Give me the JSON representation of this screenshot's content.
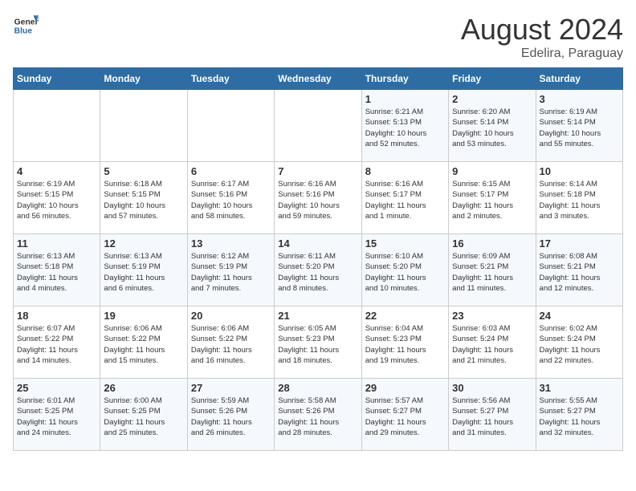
{
  "header": {
    "logo_line1": "General",
    "logo_line2": "Blue",
    "month_title": "August 2024",
    "subtitle": "Edelira, Paraguay"
  },
  "weekdays": [
    "Sunday",
    "Monday",
    "Tuesday",
    "Wednesday",
    "Thursday",
    "Friday",
    "Saturday"
  ],
  "weeks": [
    [
      {
        "day": "",
        "info": ""
      },
      {
        "day": "",
        "info": ""
      },
      {
        "day": "",
        "info": ""
      },
      {
        "day": "",
        "info": ""
      },
      {
        "day": "1",
        "info": "Sunrise: 6:21 AM\nSunset: 5:13 PM\nDaylight: 10 hours\nand 52 minutes."
      },
      {
        "day": "2",
        "info": "Sunrise: 6:20 AM\nSunset: 5:14 PM\nDaylight: 10 hours\nand 53 minutes."
      },
      {
        "day": "3",
        "info": "Sunrise: 6:19 AM\nSunset: 5:14 PM\nDaylight: 10 hours\nand 55 minutes."
      }
    ],
    [
      {
        "day": "4",
        "info": "Sunrise: 6:19 AM\nSunset: 5:15 PM\nDaylight: 10 hours\nand 56 minutes."
      },
      {
        "day": "5",
        "info": "Sunrise: 6:18 AM\nSunset: 5:15 PM\nDaylight: 10 hours\nand 57 minutes."
      },
      {
        "day": "6",
        "info": "Sunrise: 6:17 AM\nSunset: 5:16 PM\nDaylight: 10 hours\nand 58 minutes."
      },
      {
        "day": "7",
        "info": "Sunrise: 6:16 AM\nSunset: 5:16 PM\nDaylight: 10 hours\nand 59 minutes."
      },
      {
        "day": "8",
        "info": "Sunrise: 6:16 AM\nSunset: 5:17 PM\nDaylight: 11 hours\nand 1 minute."
      },
      {
        "day": "9",
        "info": "Sunrise: 6:15 AM\nSunset: 5:17 PM\nDaylight: 11 hours\nand 2 minutes."
      },
      {
        "day": "10",
        "info": "Sunrise: 6:14 AM\nSunset: 5:18 PM\nDaylight: 11 hours\nand 3 minutes."
      }
    ],
    [
      {
        "day": "11",
        "info": "Sunrise: 6:13 AM\nSunset: 5:18 PM\nDaylight: 11 hours\nand 4 minutes."
      },
      {
        "day": "12",
        "info": "Sunrise: 6:13 AM\nSunset: 5:19 PM\nDaylight: 11 hours\nand 6 minutes."
      },
      {
        "day": "13",
        "info": "Sunrise: 6:12 AM\nSunset: 5:19 PM\nDaylight: 11 hours\nand 7 minutes."
      },
      {
        "day": "14",
        "info": "Sunrise: 6:11 AM\nSunset: 5:20 PM\nDaylight: 11 hours\nand 8 minutes."
      },
      {
        "day": "15",
        "info": "Sunrise: 6:10 AM\nSunset: 5:20 PM\nDaylight: 11 hours\nand 10 minutes."
      },
      {
        "day": "16",
        "info": "Sunrise: 6:09 AM\nSunset: 5:21 PM\nDaylight: 11 hours\nand 11 minutes."
      },
      {
        "day": "17",
        "info": "Sunrise: 6:08 AM\nSunset: 5:21 PM\nDaylight: 11 hours\nand 12 minutes."
      }
    ],
    [
      {
        "day": "18",
        "info": "Sunrise: 6:07 AM\nSunset: 5:22 PM\nDaylight: 11 hours\nand 14 minutes."
      },
      {
        "day": "19",
        "info": "Sunrise: 6:06 AM\nSunset: 5:22 PM\nDaylight: 11 hours\nand 15 minutes."
      },
      {
        "day": "20",
        "info": "Sunrise: 6:06 AM\nSunset: 5:22 PM\nDaylight: 11 hours\nand 16 minutes."
      },
      {
        "day": "21",
        "info": "Sunrise: 6:05 AM\nSunset: 5:23 PM\nDaylight: 11 hours\nand 18 minutes."
      },
      {
        "day": "22",
        "info": "Sunrise: 6:04 AM\nSunset: 5:23 PM\nDaylight: 11 hours\nand 19 minutes."
      },
      {
        "day": "23",
        "info": "Sunrise: 6:03 AM\nSunset: 5:24 PM\nDaylight: 11 hours\nand 21 minutes."
      },
      {
        "day": "24",
        "info": "Sunrise: 6:02 AM\nSunset: 5:24 PM\nDaylight: 11 hours\nand 22 minutes."
      }
    ],
    [
      {
        "day": "25",
        "info": "Sunrise: 6:01 AM\nSunset: 5:25 PM\nDaylight: 11 hours\nand 24 minutes."
      },
      {
        "day": "26",
        "info": "Sunrise: 6:00 AM\nSunset: 5:25 PM\nDaylight: 11 hours\nand 25 minutes."
      },
      {
        "day": "27",
        "info": "Sunrise: 5:59 AM\nSunset: 5:26 PM\nDaylight: 11 hours\nand 26 minutes."
      },
      {
        "day": "28",
        "info": "Sunrise: 5:58 AM\nSunset: 5:26 PM\nDaylight: 11 hours\nand 28 minutes."
      },
      {
        "day": "29",
        "info": "Sunrise: 5:57 AM\nSunset: 5:27 PM\nDaylight: 11 hours\nand 29 minutes."
      },
      {
        "day": "30",
        "info": "Sunrise: 5:56 AM\nSunset: 5:27 PM\nDaylight: 11 hours\nand 31 minutes."
      },
      {
        "day": "31",
        "info": "Sunrise: 5:55 AM\nSunset: 5:27 PM\nDaylight: 11 hours\nand 32 minutes."
      }
    ]
  ]
}
